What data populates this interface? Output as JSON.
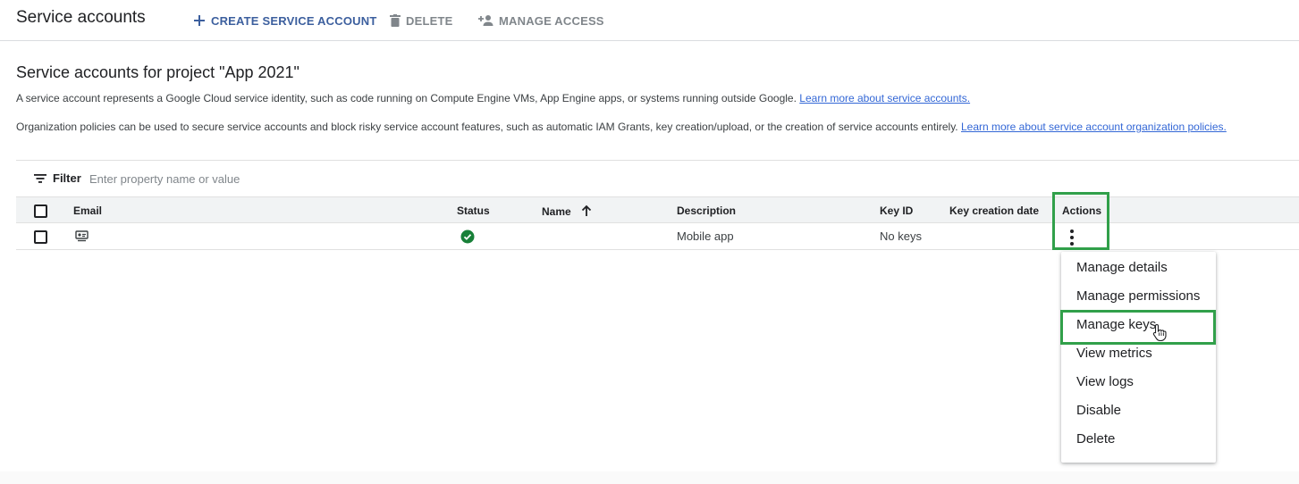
{
  "header": {
    "title": "Service accounts",
    "create_label": "CREATE SERVICE ACCOUNT",
    "delete_label": "DELETE",
    "manage_access_label": "MANAGE ACCESS"
  },
  "section": {
    "title": "Service accounts for project \"App 2021\"",
    "desc1_text": "A service account represents a Google Cloud service identity, such as code running on Compute Engine VMs, App Engine apps, or systems running outside Google.",
    "desc1_link": "Learn more about service accounts.",
    "desc2_text": "Organization policies can be used to secure service accounts and block risky service account features, such as automatic IAM Grants, key creation/upload, or the creation of service accounts entirely.",
    "desc2_link": "Learn more about service account organization policies."
  },
  "filter": {
    "label": "Filter",
    "placeholder": "Enter property name or value"
  },
  "table": {
    "columns": [
      "Email",
      "Status",
      "Name",
      "Description",
      "Key ID",
      "Key creation date",
      "Actions"
    ],
    "rows": [
      {
        "email_icon": "service-account-icon",
        "status_icon": "check-circle-icon",
        "name": "",
        "description": "Mobile app",
        "key_id": "No keys",
        "key_creation_date": ""
      }
    ]
  },
  "menu": {
    "items": [
      "Manage details",
      "Manage permissions",
      "Manage keys",
      "View metrics",
      "View logs",
      "Disable",
      "Delete"
    ]
  },
  "colors": {
    "highlight": "#31a04a",
    "link": "#3367d6",
    "status_ok": "#188038"
  }
}
